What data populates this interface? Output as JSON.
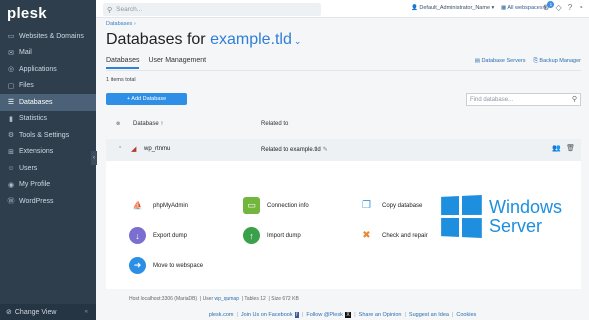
{
  "app": {
    "logo": "plesk"
  },
  "sidebar": {
    "items": [
      {
        "label": "Websites & Domains",
        "icon": "websites-icon",
        "glyph": "▭"
      },
      {
        "label": "Mail",
        "icon": "mail-icon",
        "glyph": "✉"
      },
      {
        "label": "Applications",
        "icon": "applications-icon",
        "glyph": "◎"
      },
      {
        "label": "Files",
        "icon": "files-icon",
        "glyph": "▢"
      },
      {
        "label": "Databases",
        "icon": "databases-icon",
        "glyph": "☰"
      },
      {
        "label": "Statistics",
        "icon": "statistics-icon",
        "glyph": "▮"
      },
      {
        "label": "Tools & Settings",
        "icon": "tools-icon",
        "glyph": "⚙"
      },
      {
        "label": "Extensions",
        "icon": "extensions-icon",
        "glyph": "⊞"
      },
      {
        "label": "Users",
        "icon": "users-icon",
        "glyph": "☺"
      },
      {
        "label": "My Profile",
        "icon": "profile-icon",
        "glyph": "◉"
      },
      {
        "label": "WordPress",
        "icon": "wordpress-icon",
        "glyph": "Ⓦ"
      }
    ],
    "active_index": 4,
    "change_view": "Change View"
  },
  "topbar": {
    "search_placeholder": "Search...",
    "user": "Default_Administrator_Name",
    "workspaces": "All webspaces",
    "notification_count": "1"
  },
  "main": {
    "breadcrumb": "Databases",
    "title_prefix": "Databases for",
    "title_domain": "example.tld",
    "tabs": [
      {
        "label": "Databases",
        "active": true
      },
      {
        "label": "User Management",
        "active": false
      }
    ],
    "links": {
      "servers": "Database Servers",
      "backup": "Backup Manager"
    },
    "items_total": "1 items total",
    "add_button": "+ Add Database",
    "find_placeholder": "Find database...",
    "columns": {
      "database": "Database",
      "related": "Related to"
    },
    "row": {
      "name": "wp_rtnmu",
      "related": "Related to example.tld"
    },
    "tools": {
      "phpmyadmin": "phpMyAdmin",
      "connection": "Connection info",
      "copy": "Copy database",
      "export": "Export dump",
      "import": "Import dump",
      "check": "Check and repair",
      "move": "Move to webspace"
    },
    "meta": {
      "host_label": "Host",
      "host": "localhost:3306 (MariaDB)",
      "user_label": "User",
      "user": "wp_qumap",
      "tables_label": "Tables",
      "tables": "12",
      "size_label": "Size",
      "size": "672 KB"
    }
  },
  "overlay": {
    "line1": "Windows",
    "line2": "Server",
    "color": "#1e8fde"
  },
  "footer": {
    "links": [
      "plesk.com",
      "Join Us on Facebook",
      "Follow @Plesk",
      "Share an Opinion",
      "Suggest an Idea",
      "Cookies"
    ]
  }
}
